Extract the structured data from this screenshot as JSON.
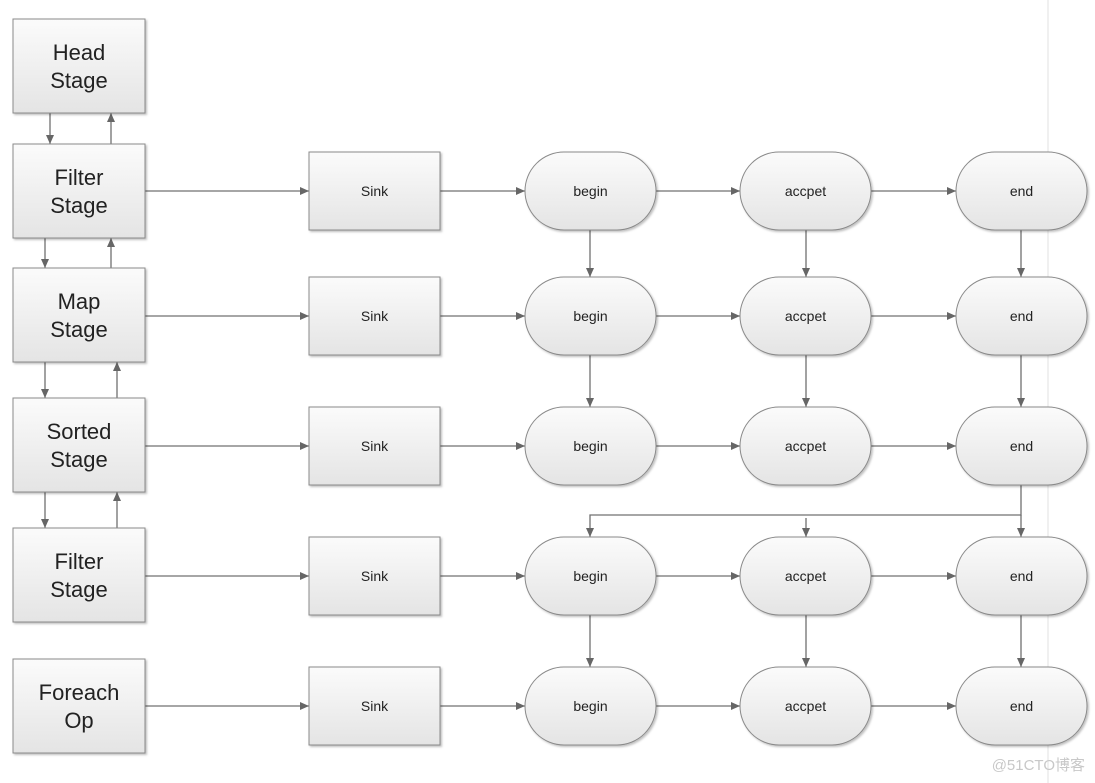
{
  "stages": [
    {
      "lines": [
        "Head",
        "Stage"
      ]
    },
    {
      "lines": [
        "Filter",
        "Stage"
      ]
    },
    {
      "lines": [
        "Map",
        "Stage"
      ]
    },
    {
      "lines": [
        "Sorted",
        "Stage"
      ]
    },
    {
      "lines": [
        "Filter",
        "Stage"
      ]
    },
    {
      "lines": [
        "Foreach",
        "Op"
      ]
    }
  ],
  "rows": [
    {
      "sink": "Sink",
      "begin": "begin",
      "accept": "accpet",
      "end": "end"
    },
    {
      "sink": "Sink",
      "begin": "begin",
      "accept": "accpet",
      "end": "end"
    },
    {
      "sink": "Sink",
      "begin": "begin",
      "accept": "accpet",
      "end": "end"
    },
    {
      "sink": "Sink",
      "begin": "begin",
      "accept": "accpet",
      "end": "end"
    },
    {
      "sink": "Sink",
      "begin": "begin",
      "accept": "accpet",
      "end": "end"
    }
  ],
  "watermark": "@51CTO博客",
  "colors": {
    "line": "#707070",
    "border": "#8a8a8a",
    "fill_top": "#fbfbfb",
    "fill_bottom": "#e6e6e6"
  }
}
